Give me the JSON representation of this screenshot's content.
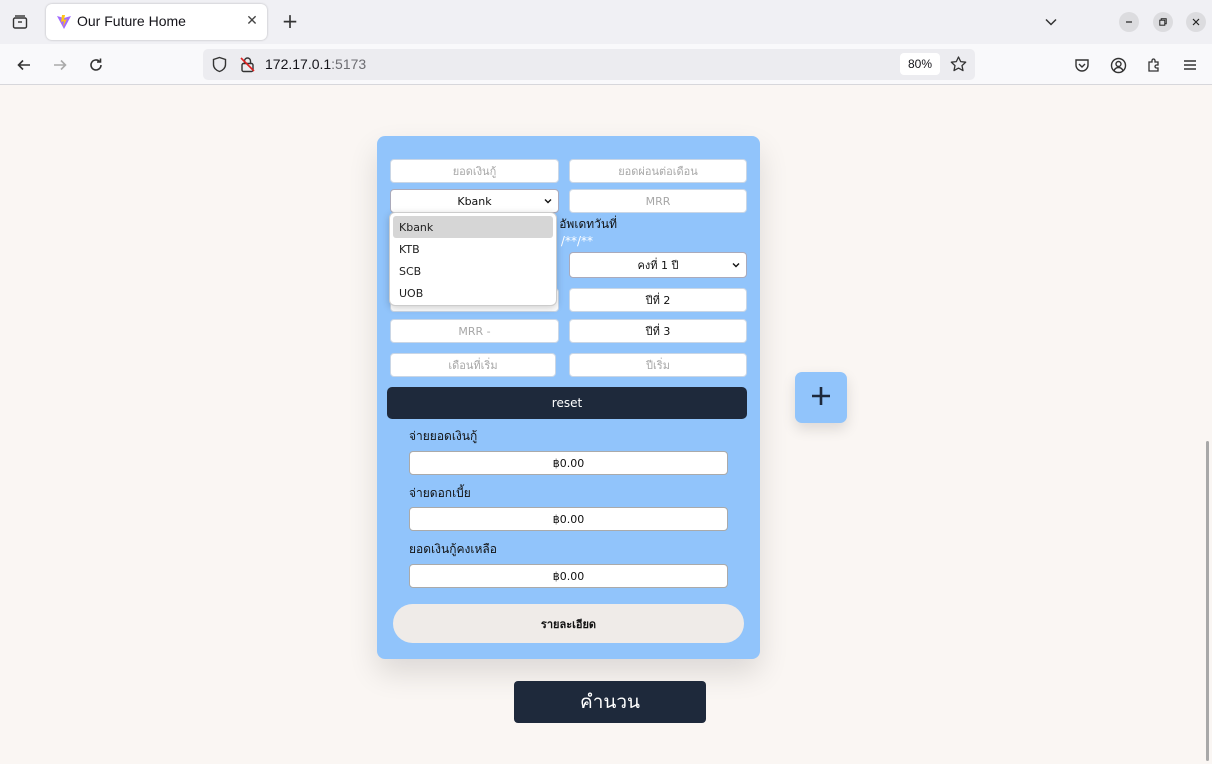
{
  "browser": {
    "tab_title": "Our Future Home",
    "url_host": "172.17.0.1",
    "url_port": ":5173",
    "zoom": "80%"
  },
  "form": {
    "loan_amount_placeholder": "ยอดเงินกู้",
    "monthly_payment_placeholder": "ยอดผ่อนต่อเดือน",
    "bank_selected": "Kbank",
    "mrr_placeholder": "MRR",
    "update_label": "อัพเดทวันที่",
    "update_hint": "/**/**",
    "fixed_rate_selected": "คงที่ 1 ปี",
    "year2_label": "ปีที่ 2",
    "mrr_minus_placeholder": "MRR -",
    "year3_label": "ปีที่ 3",
    "start_month_placeholder": "เดือนที่เริ่ม",
    "start_year_placeholder": "ปีเริ่ม",
    "reset_label": "reset"
  },
  "bank_options": [
    "Kbank",
    "KTB",
    "SCB",
    "UOB"
  ],
  "results": {
    "principal_label": "จ่ายยอดเงินกู้",
    "principal_value": "฿0.00",
    "interest_label": "จ่ายดอกเบี้ย",
    "interest_value": "฿0.00",
    "remaining_label": "ยอดเงินกู้คงเหลือ",
    "remaining_value": "฿0.00",
    "details_label": "รายละเอียด"
  },
  "calculate_label": "คำนวน",
  "colors": {
    "card": "#91c4fb",
    "dark": "#1e293b",
    "page_bg": "#faf6f3"
  }
}
